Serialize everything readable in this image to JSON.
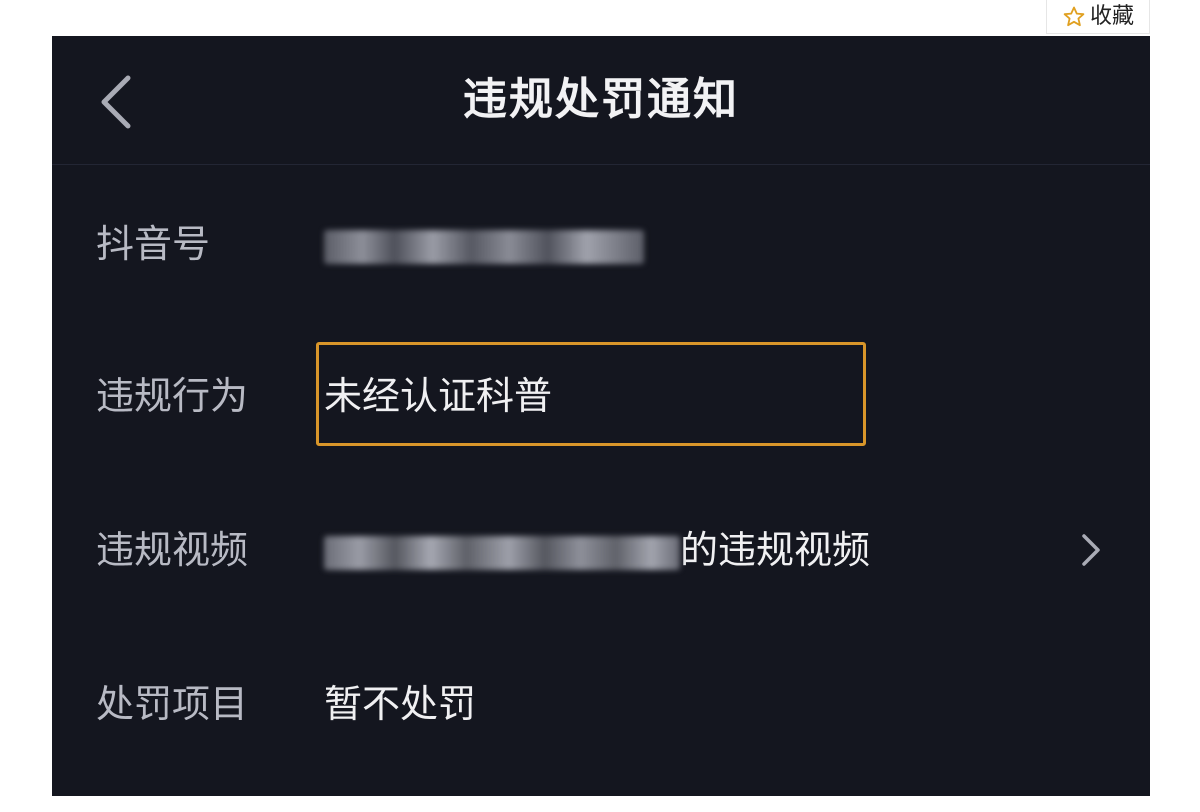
{
  "favorite": {
    "icon": "star-outline-icon",
    "label": "收藏"
  },
  "header": {
    "back_icon": "chevron-left-icon",
    "title": "违规处罚通知"
  },
  "rows": [
    {
      "label": "抖音号",
      "value_obscured": true
    },
    {
      "label": "违规行为",
      "value": "未经认证科普",
      "highlighted": true
    },
    {
      "label": "违规视频",
      "value_suffix": "的违规视频",
      "value_prefix_obscured": true,
      "action_icon": "chevron-right-icon"
    },
    {
      "label": "处罚项目",
      "value": "暂不处罚"
    }
  ],
  "colors": {
    "background": "#14161f",
    "highlight_border": "#d9962a",
    "star": "#e0a020"
  }
}
